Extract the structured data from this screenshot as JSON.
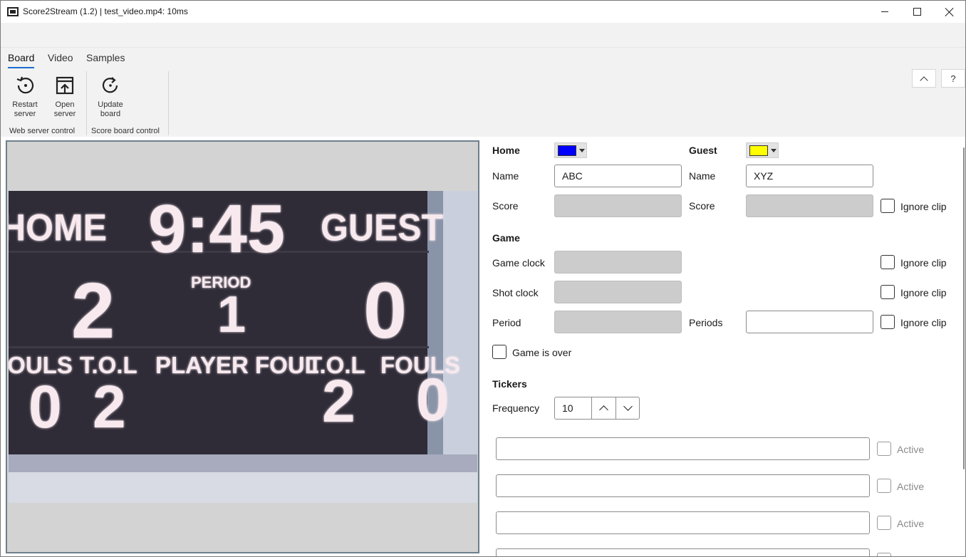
{
  "window": {
    "title": "Score2Stream (1.2) | test_video.mp4: 10ms",
    "app_icon": "scoreboard-icon",
    "controls": [
      "minimize-icon",
      "maximize-icon",
      "close-icon"
    ]
  },
  "ribbon": {
    "tabs": [
      {
        "label": "Board",
        "active": true
      },
      {
        "label": "Video",
        "active": false
      },
      {
        "label": "Samples",
        "active": false
      }
    ],
    "collapse_icon": "chevron-up-icon",
    "help_label": "?",
    "buttons": [
      {
        "line1": "Restart",
        "line2": "server",
        "icon": "restart-icon"
      },
      {
        "line1": "Open",
        "line2": "server",
        "icon": "open-in-browser-icon"
      },
      {
        "line1": "Update",
        "line2": "board",
        "icon": "refresh-icon"
      }
    ],
    "groups": [
      "Web server control",
      "Score board control"
    ]
  },
  "scoreboard_image": {
    "home_label": "HOME",
    "guest_label": "GUEST",
    "clock": "9:45",
    "home_score": "2",
    "guest_score": "0",
    "period_label": "PERIOD",
    "period": "1",
    "fouls_label": "FOULS",
    "tol_label": "T.O.L",
    "player_foul_label": "PLAYER FOUL",
    "home_fouls": "0",
    "home_tol": "2",
    "guest_tol": "2",
    "guest_fouls": "0"
  },
  "board": {
    "home": {
      "heading": "Home",
      "color": "#0000ff",
      "name_label": "Name",
      "name_value": "ABC",
      "score_label": "Score",
      "score_value": ""
    },
    "guest": {
      "heading": "Guest",
      "color": "#ffff00",
      "name_label": "Name",
      "name_value": "XYZ",
      "score_label": "Score",
      "score_value": ""
    },
    "ignore_clip_label": "Ignore clip",
    "game": {
      "heading": "Game",
      "game_clock_label": "Game clock",
      "shot_clock_label": "Shot clock",
      "period_label": "Period",
      "periods_label": "Periods",
      "periods_value": "",
      "game_over_label": "Game is over"
    },
    "tickers": {
      "heading": "Tickers",
      "frequency_label": "Frequency",
      "frequency_value": "10",
      "active_label": "Active",
      "rows": [
        "",
        "",
        "",
        ""
      ]
    }
  }
}
